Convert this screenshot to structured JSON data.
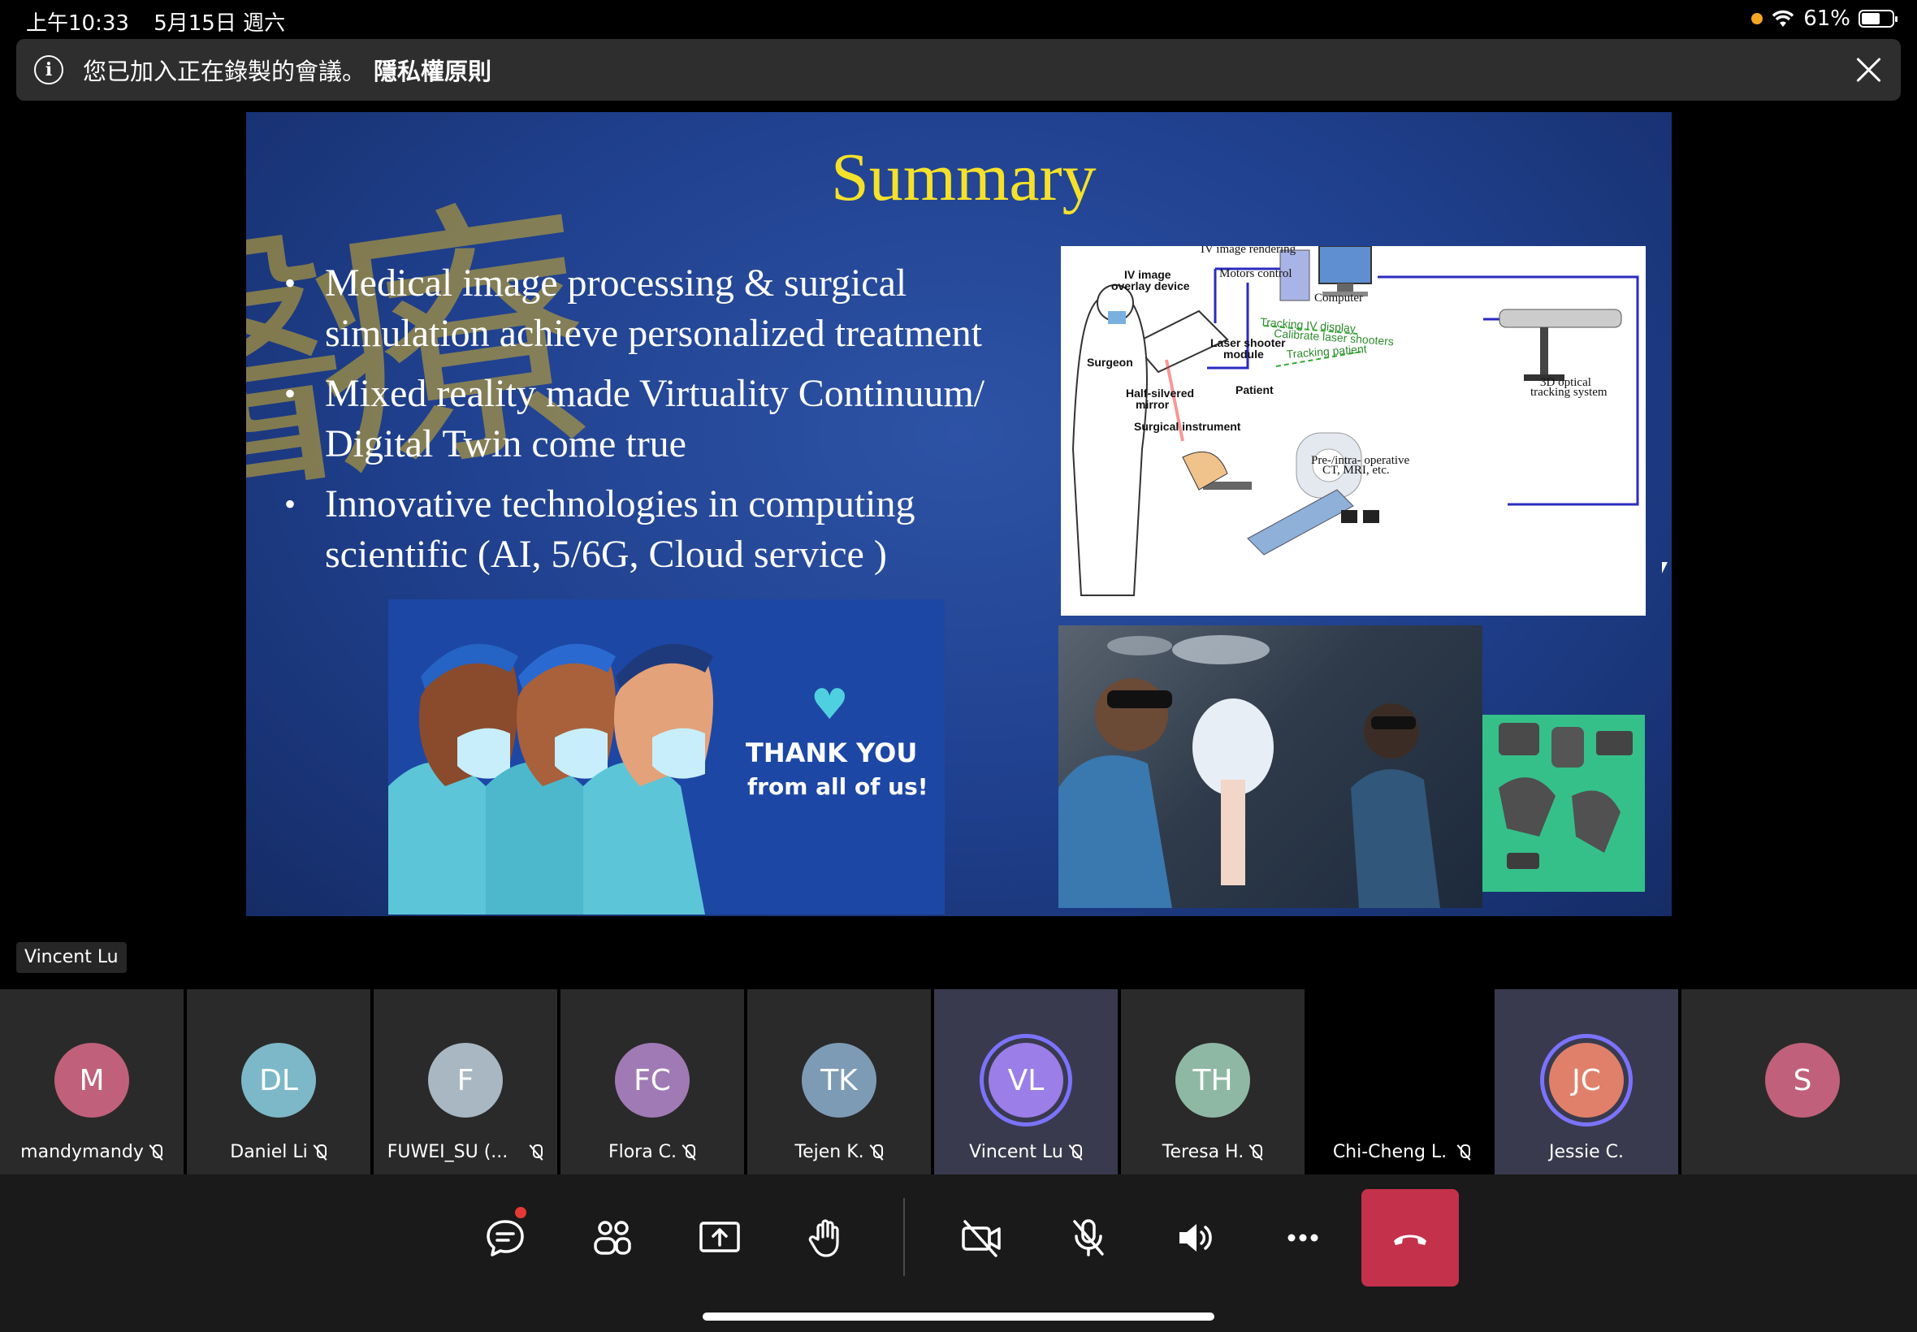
{
  "status_bar": {
    "time": "上午10:33",
    "date": "5月15日 週六",
    "battery": "61%",
    "battery_level": 0.61
  },
  "banner": {
    "message": "您已加入正在錄製的會議。",
    "link": "隱私權原則"
  },
  "slide": {
    "title": "Summary",
    "bullets": [
      "Medical image processing & surgical simulation achieve personalized treatment",
      "Mixed reality made Virtuality Continuum/ Digital Twin  come true",
      "Innovative technologies in computing scientific (AI, 5/6G, Cloud service )"
    ],
    "diagram": {
      "iv_rendering": "IV image rendering",
      "motors": "Motors control",
      "overlay": "IV image",
      "overlay2": "overlay device",
      "computer": "Computer",
      "tracking_iv": "Tracking IV display",
      "calibrate": "Calibrate laser shooters",
      "tracking_patient": "Tracking patient",
      "laser": "Laser shooter",
      "laser2": "module",
      "surgeon": "Surgeon",
      "optical": "3D optical",
      "optical2": "tracking system",
      "patient": "Patient",
      "mirror": "Half-silvered",
      "mirror2": "mirror",
      "instrument": "Surgical instrument",
      "ct": "Pre-/intra- operative",
      "ct2": "CT, MRI, etc."
    },
    "thank_title": "THANK YOU",
    "thank_sub": "from all of us!"
  },
  "speaker_tag": "Vincent Lu",
  "participants": [
    {
      "initials": "M",
      "name": "mandymandy",
      "color": "#c1607a"
    },
    {
      "initials": "DL",
      "name": "Daniel Li",
      "color": "#7cb8c8"
    },
    {
      "initials": "F",
      "name": "FUWEI_SU (...",
      "color": "#a9b7c2"
    },
    {
      "initials": "FC",
      "name": "Flora C.",
      "color": "#a07ab4"
    },
    {
      "initials": "TK",
      "name": "Tejen K.",
      "color": "#7e9bb6"
    },
    {
      "initials": "VL",
      "name": "Vincent Lu",
      "color": "#9b7ee8"
    },
    {
      "initials": "TH",
      "name": "Teresa H.",
      "color": "#8fb8a4"
    },
    {
      "initials": "",
      "name": "Chi-Cheng L.",
      "color": "#000000"
    },
    {
      "initials": "JC",
      "name": "Jessie C.",
      "color": "#e0806a"
    },
    {
      "initials": "S",
      "name": "",
      "color": "#c1607a"
    }
  ],
  "colors": {
    "hangup": "#c4314b",
    "speaking_ring": "#7b73ff",
    "slide_title": "#f5e12a"
  }
}
